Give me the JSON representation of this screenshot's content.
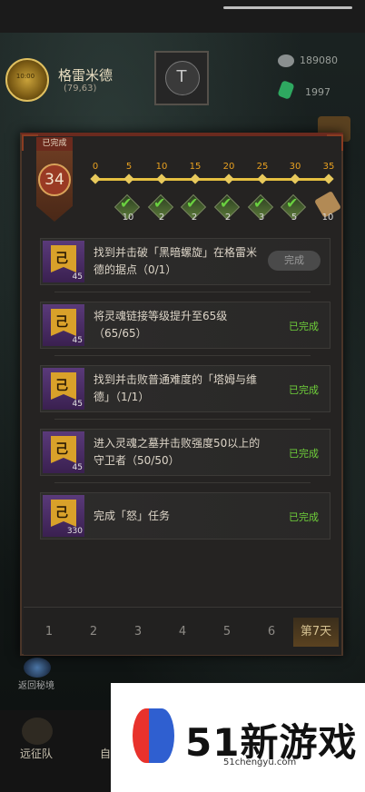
{
  "header": {
    "player_name": "格雷米德",
    "player_coords": "(79,63)",
    "avatar_text": "10:00",
    "center_button_glyph": "T",
    "resource_1": "189080",
    "resource_2": "1997"
  },
  "panel": {
    "completed_tag": "已完成",
    "score": "34",
    "milestones": [
      "0",
      "5",
      "10",
      "15",
      "20",
      "25",
      "30",
      "35"
    ],
    "rewards": [
      "10",
      "2",
      "2",
      "2",
      "3",
      "5",
      "10"
    ]
  },
  "tasks": [
    {
      "text": "找到并击破「黑暗螺旋」在格雷米德的据点（0/1）",
      "qty": "45",
      "status": "完成",
      "status_type": "button"
    },
    {
      "text": "将灵魂链接等级提升至65级（65/65）",
      "qty": "45",
      "status": "已完成",
      "status_type": "done"
    },
    {
      "text": "找到并击败普通难度的「塔姆与维德」（1/1）",
      "qty": "45",
      "status": "已完成",
      "status_type": "done"
    },
    {
      "text": "进入灵魂之墓并击败强度50以上的守卫者（50/50）",
      "qty": "45",
      "status": "已完成",
      "status_type": "done"
    },
    {
      "text": "完成「怒」任务",
      "qty": "330",
      "status": "已完成",
      "status_type": "done"
    }
  ],
  "days": [
    "1",
    "2",
    "3",
    "4",
    "5",
    "6",
    "第7天"
  ],
  "background": {
    "back_label": "返回秘境",
    "bottom_label_1": "远征队",
    "bottom_label_2": "自"
  },
  "watermark": {
    "text": "51新游戏",
    "url": "51chengyu.com"
  },
  "colors": {
    "accent_gold": "#e8a020",
    "done_green": "#6fcf3a",
    "banner_red": "#9a3a24"
  }
}
